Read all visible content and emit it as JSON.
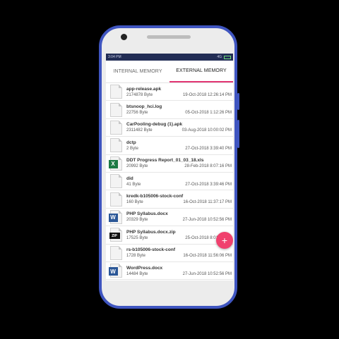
{
  "status_bar": {
    "time": "3:04 PM",
    "icons": "4G",
    "battery_color": "#6fdc7a"
  },
  "tabs": [
    {
      "label": "INTERNAL MEMORY",
      "active": false
    },
    {
      "label": "EXTERNAL MEMORY",
      "active": true
    }
  ],
  "files": [
    {
      "name": "app-release.apk",
      "size": "2174878 Byte",
      "date": "19-Oct-2018 12:26:14 PM",
      "icon": "file-icon"
    },
    {
      "name": "btsnoop_hci.log",
      "size": "22756 Byte",
      "date": "05-Oct-2018 1:12:26 PM",
      "icon": "file-icon"
    },
    {
      "name": "CarPooling-debug (1).apk",
      "size": "2311482 Byte",
      "date": "03-Aug-2018 10:00:02 PM",
      "icon": "file-icon"
    },
    {
      "name": "dctp",
      "size": "2 Byte",
      "date": "27-Oct-2018 3:39:40 PM",
      "icon": "file-icon"
    },
    {
      "name": "DDT Progress Report_01_03_18.xls",
      "size": "20992 Byte",
      "date": "28-Feb-2018 8:07:16 PM",
      "icon": "excel-icon"
    },
    {
      "name": "did",
      "size": "41 Byte",
      "date": "27-Oct-2018 3:39:46 PM",
      "icon": "file-icon"
    },
    {
      "name": "kredk-b105006-stock-conf",
      "size": "160 Byte",
      "date": "16-Oct-2018 11:37:17 PM",
      "icon": "file-icon"
    },
    {
      "name": "PHP  Syllabus.docx",
      "size": "20329 Byte",
      "date": "27-Jun-2018 10:52:56 PM",
      "icon": "word-icon"
    },
    {
      "name": "PHP  Syllabus.docx.zip",
      "size": "17525 Byte",
      "date": "25-Oct-2018 8:01:37 PM",
      "icon": "zip-icon"
    },
    {
      "name": "rs-b105006-stock-conf",
      "size": "1728 Byte",
      "date": "16-Oct-2018 11:56:06 PM",
      "icon": "file-icon"
    },
    {
      "name": "WordPress.docx",
      "size": "14484 Byte",
      "date": "27-Jun-2018 10:52:56 PM",
      "icon": "word-icon"
    }
  ],
  "badges": {
    "excel": "X",
    "word": "W",
    "zip": "ZIP"
  },
  "fab": {
    "symbol": "+",
    "color": "#f0416e"
  },
  "colors": {
    "accent": "#e23573",
    "phone_frame": "#3f55c0",
    "status_bar": "#222d55"
  }
}
